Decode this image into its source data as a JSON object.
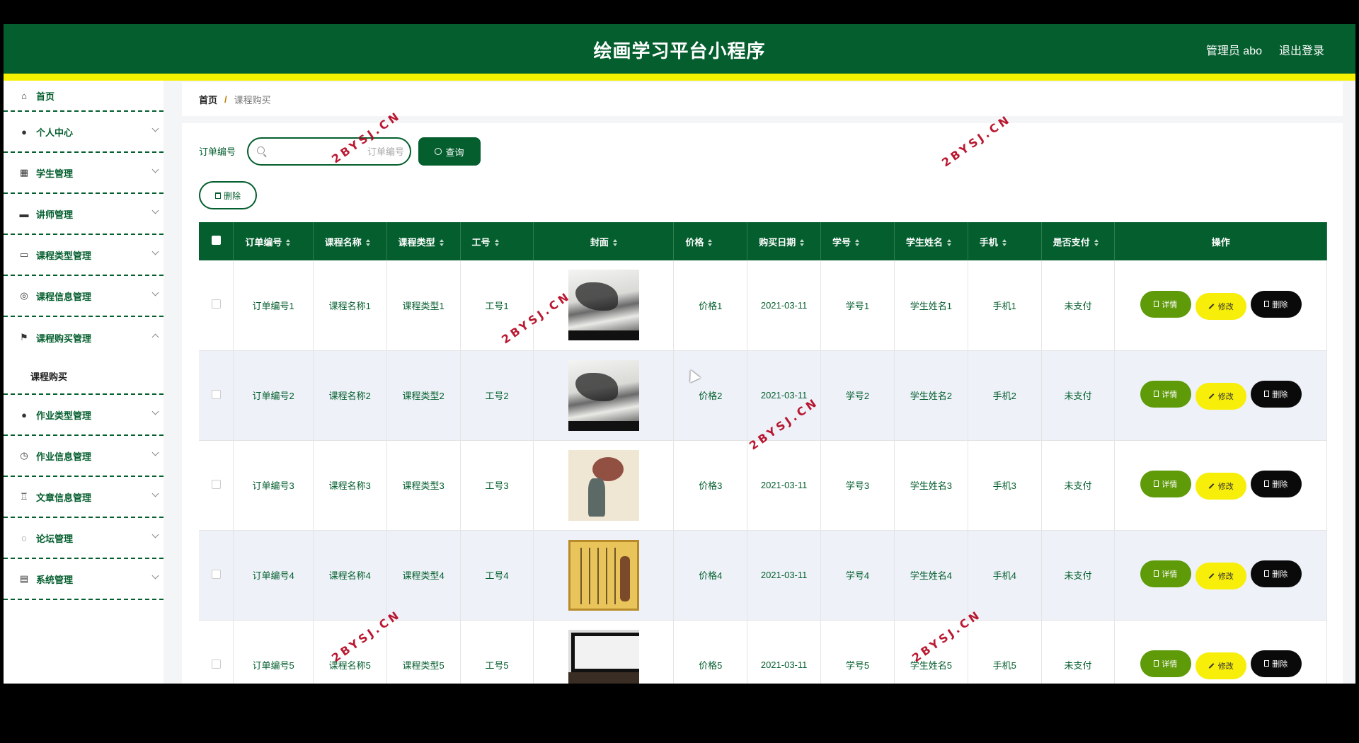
{
  "header": {
    "title": "绘画学习平台小程序",
    "admin": "管理员 abo",
    "logout": "退出登录"
  },
  "sidebar": {
    "items": [
      {
        "label": "首页",
        "icon": "home-icon",
        "glyph": "⌂"
      },
      {
        "label": "个人中心",
        "icon": "user-icon",
        "glyph": "●"
      },
      {
        "label": "学生管理",
        "icon": "grid-icon",
        "glyph": "▦"
      },
      {
        "label": "讲师管理",
        "icon": "briefcase-icon",
        "glyph": "▬"
      },
      {
        "label": "课程类型管理",
        "icon": "monitor-icon",
        "glyph": "▭"
      },
      {
        "label": "课程信息管理",
        "icon": "globe-icon",
        "glyph": "◎"
      },
      {
        "label": "课程购买管理",
        "icon": "flag-icon",
        "glyph": "⚑"
      },
      {
        "label": "作业类型管理",
        "icon": "user-icon",
        "glyph": "●"
      },
      {
        "label": "作业信息管理",
        "icon": "clock-icon",
        "glyph": "◷"
      },
      {
        "label": "文章信息管理",
        "icon": "trophy-icon",
        "glyph": "♖"
      },
      {
        "label": "论坛管理",
        "icon": "compass-icon",
        "glyph": "◌"
      },
      {
        "label": "系统管理",
        "icon": "clipboard-icon",
        "glyph": "▤"
      }
    ],
    "submenu": "课程购买"
  },
  "breadcrumb": {
    "home": "首页",
    "separator": "/",
    "current": "课程购买"
  },
  "search": {
    "label": "订单编号",
    "placeholder": "订单编号",
    "value": "",
    "button": "查询"
  },
  "actions": {
    "delete": "删除"
  },
  "table": {
    "headers": [
      "订单编号",
      "课程名称",
      "课程类型",
      "工号",
      "封面",
      "价格",
      "购买日期",
      "学号",
      "学生姓名",
      "手机",
      "是否支付",
      "操作"
    ],
    "rows": [
      {
        "order": "订单编号1",
        "course": "课程名称1",
        "type": "课程类型1",
        "staff": "工号1",
        "cover": "ink",
        "price": "价格1",
        "date": "2021-03-11",
        "sid": "学号1",
        "sname": "学生姓名1",
        "phone": "手机1",
        "paid": "未支付"
      },
      {
        "order": "订单编号2",
        "course": "课程名称2",
        "type": "课程类型2",
        "staff": "工号2",
        "cover": "ink",
        "price": "价格2",
        "date": "2021-03-11",
        "sid": "学号2",
        "sname": "学生姓名2",
        "phone": "手机2",
        "paid": "未支付"
      },
      {
        "order": "订单编号3",
        "course": "课程名称3",
        "type": "课程类型3",
        "staff": "工号3",
        "cover": "tree",
        "price": "价格3",
        "date": "2021-03-11",
        "sid": "学号3",
        "sname": "学生姓名3",
        "phone": "手机3",
        "paid": "未支付"
      },
      {
        "order": "订单编号4",
        "course": "课程名称4",
        "type": "课程类型4",
        "staff": "工号4",
        "cover": "calli",
        "price": "价格4",
        "date": "2021-03-11",
        "sid": "学号4",
        "sname": "学生姓名4",
        "phone": "手机4",
        "paid": "未支付"
      },
      {
        "order": "订单编号5",
        "course": "课程名称5",
        "type": "课程类型5",
        "staff": "工号5",
        "cover": "frame",
        "price": "价格5",
        "date": "2021-03-11",
        "sid": "学号5",
        "sname": "学生姓名5",
        "phone": "手机5",
        "paid": "未支付"
      }
    ],
    "row_actions": {
      "detail": "详情",
      "edit": "修改",
      "delete": "删除"
    }
  },
  "watermark": "2BYSJ.CN",
  "colors": {
    "primary": "#045e2e",
    "accent_stripe": "#f4f000",
    "detail": "#5f9a09",
    "edit": "#f7ee0a",
    "delete": "#0a0a0a"
  }
}
